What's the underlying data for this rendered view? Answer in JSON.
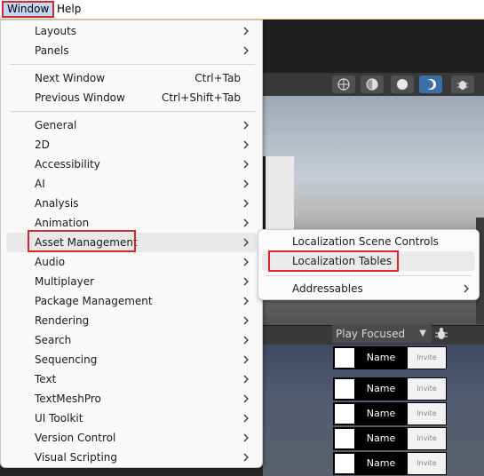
{
  "menubar": {
    "window": "Window",
    "help": "Help"
  },
  "window_menu": {
    "items": [
      {
        "label": "Layouts",
        "shortcut": "",
        "submenu": true
      },
      {
        "label": "Panels",
        "shortcut": "",
        "submenu": true
      },
      {
        "label": "Next Window",
        "shortcut": "Ctrl+Tab",
        "submenu": false
      },
      {
        "label": "Previous Window",
        "shortcut": "Ctrl+Shift+Tab",
        "submenu": false
      },
      {
        "label": "General",
        "shortcut": "",
        "submenu": true
      },
      {
        "label": "2D",
        "shortcut": "",
        "submenu": true
      },
      {
        "label": "Accessibility",
        "shortcut": "",
        "submenu": true
      },
      {
        "label": "AI",
        "shortcut": "",
        "submenu": true
      },
      {
        "label": "Analysis",
        "shortcut": "",
        "submenu": true
      },
      {
        "label": "Animation",
        "shortcut": "",
        "submenu": true
      },
      {
        "label": "Asset Management",
        "shortcut": "",
        "submenu": true
      },
      {
        "label": "Audio",
        "shortcut": "",
        "submenu": true
      },
      {
        "label": "Multiplayer",
        "shortcut": "",
        "submenu": true
      },
      {
        "label": "Package Management",
        "shortcut": "",
        "submenu": true
      },
      {
        "label": "Rendering",
        "shortcut": "",
        "submenu": true
      },
      {
        "label": "Search",
        "shortcut": "",
        "submenu": true
      },
      {
        "label": "Sequencing",
        "shortcut": "",
        "submenu": true
      },
      {
        "label": "Text",
        "shortcut": "",
        "submenu": true
      },
      {
        "label": "TextMeshPro",
        "shortcut": "",
        "submenu": true
      },
      {
        "label": "UI Toolkit",
        "shortcut": "",
        "submenu": true
      },
      {
        "label": "Version Control",
        "shortcut": "",
        "submenu": true
      },
      {
        "label": "Visual Scripting",
        "shortcut": "",
        "submenu": true
      }
    ]
  },
  "asset_management_submenu": {
    "items": [
      {
        "label": "Localization Scene Controls",
        "submenu": false
      },
      {
        "label": "Localization Tables",
        "submenu": false
      },
      {
        "label": "Addressables",
        "submenu": true
      }
    ]
  },
  "game_view": {
    "play_mode": "Play Focused",
    "rows": [
      {
        "name": "Name",
        "input": "Invite"
      },
      {
        "name": "Name",
        "input": "Invite"
      },
      {
        "name": "Name",
        "input": "Invite"
      },
      {
        "name": "Name",
        "input": "Invite"
      },
      {
        "name": "Name",
        "input": "Invite"
      }
    ]
  },
  "icons": {
    "submenu_arrow": "chevron-right-icon",
    "scene_toolbar": [
      "wireframe-globe-icon",
      "shaded-sphere-icon",
      "lit-sphere-icon",
      "moon-sphere-icon",
      "debug-bug-icon"
    ],
    "play_bug": "debug-bug-icon"
  },
  "colors": {
    "highlight_border": "#d9272e",
    "menu_background": "#f9f9f9",
    "hover_background": "#e9e9e9"
  }
}
